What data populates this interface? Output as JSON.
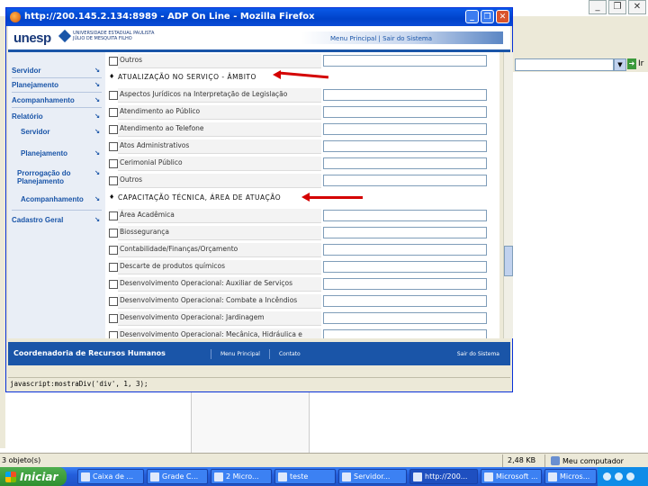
{
  "background_window": {
    "address_go_label": "Ir",
    "controls": [
      "_",
      "❐",
      "✕"
    ]
  },
  "firefox": {
    "title": "http://200.145.2.134:8989 - ADP On Line - Mozilla Firefox",
    "controls": [
      "_",
      "❐",
      "✕"
    ],
    "status_text": "javascript:mostraDiv('div', 1, 3);"
  },
  "page": {
    "logo": "unesp",
    "logo_sub_1": "UNIVERSIDADE ESTADUAL PAULISTA",
    "logo_sub_2": "JÚLIO DE MESQUITA FILHO",
    "top_nav": "Menu Principal | Sair do Sistema"
  },
  "sidebar": {
    "items": [
      {
        "label": "Servidor",
        "sub": false
      },
      {
        "label": "Planejamento",
        "sub": false
      },
      {
        "label": "Acompanhamento",
        "sub": false
      },
      {
        "label": "Relatório",
        "sub": false
      },
      {
        "label": "Servidor",
        "sub": true
      },
      {
        "label": "Planejamento",
        "sub": true
      },
      {
        "label": "Prorrogação do Planejamento",
        "sub": true
      },
      {
        "label": "Acompanhamento",
        "sub": true
      },
      {
        "label": "Cadastro Geral",
        "sub": false
      }
    ]
  },
  "content": {
    "row_outros_1": "Outros",
    "section_1": "ATUALIZAÇÃO NO SERVIÇO - ÂMBITO",
    "rows_1": [
      "Aspectos Jurídicos na Interpretação de Legislação",
      "Atendimento ao Público",
      "Atendimento ao Telefone",
      "Atos Administrativos",
      "Cerimonial Público",
      "Outros"
    ],
    "section_2": "CAPACITAÇÃO TÉCNICA, ÁREA DE ATUAÇÃO",
    "rows_2": [
      "Área Acadêmica",
      "Biossegurança",
      "Contabilidade/Finanças/Orçamento",
      "Descarte de produtos químicos",
      "Desenvolvimento Operacional: Auxiliar de Serviços",
      "Desenvolvimento Operacional: Combate a Incêndios",
      "Desenvolvimento Operacional: Jardinagem",
      "Desenvolvimento Operacional: Mecânica, Hidráulica e"
    ],
    "annotation_arrow_color": "#d40000"
  },
  "footer": {
    "title": "Coordenadoria de Recursos Humanos",
    "nav": [
      "Menu Principal",
      "Contato"
    ],
    "right": "Sair do Sistema"
  },
  "statusbar": {
    "left": "3 objeto(s)",
    "size": "2,48 KB",
    "zone": "Meu computador"
  },
  "taskbar": {
    "start": "Iniciar",
    "tasks": [
      "Caixa de ...",
      "Grade C...",
      "2 Micro...",
      "teste",
      "Servidor...",
      "http://200...",
      "Microsoft ...",
      "Micros..."
    ],
    "clock": ""
  },
  "colors": {
    "brand_blue": "#1a55a8",
    "annotation_red": "#d40000"
  }
}
